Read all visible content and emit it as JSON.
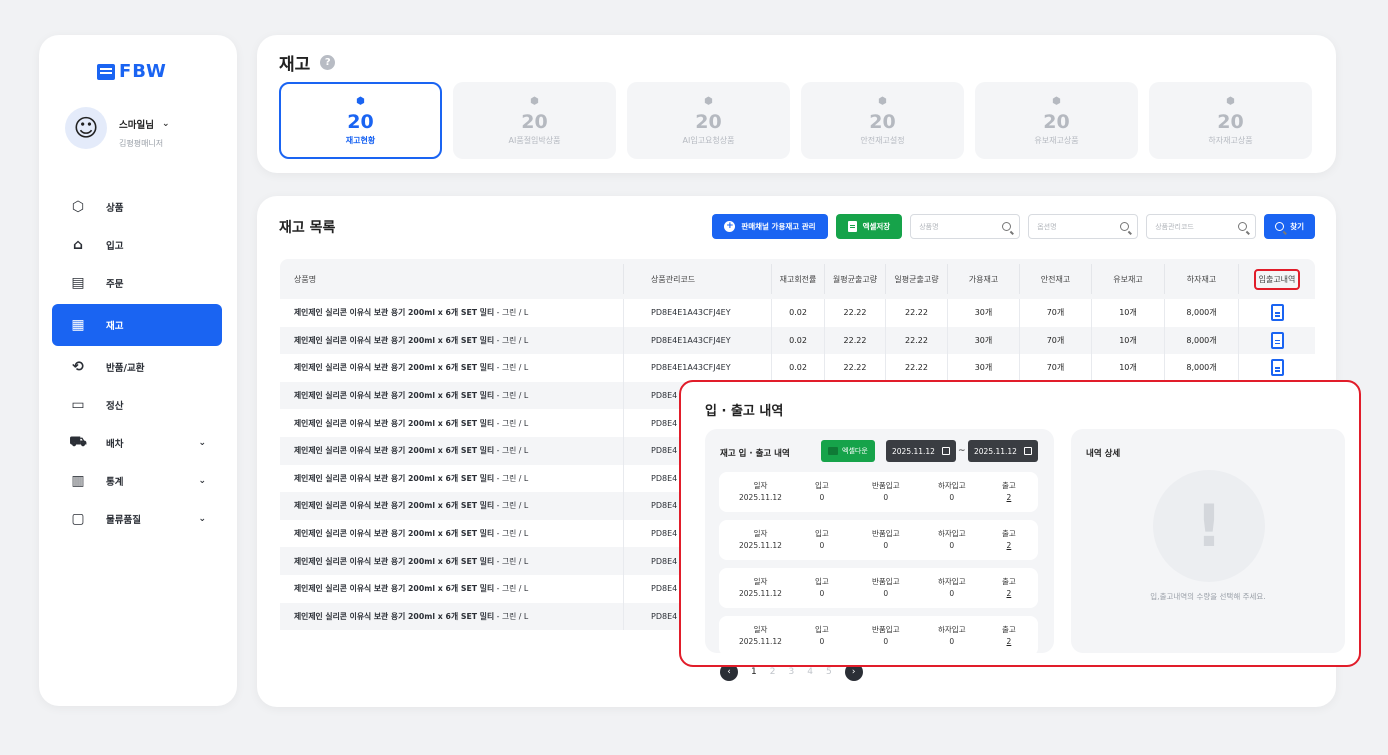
{
  "brand": {
    "logo": "FBW"
  },
  "user": {
    "name": "스마일님",
    "role": "김평평매니저"
  },
  "sidebar": {
    "items": [
      {
        "label": "상품",
        "icon": "box-icon"
      },
      {
        "label": "입고",
        "icon": "warehouse-icon"
      },
      {
        "label": "주문",
        "icon": "receipt-icon"
      },
      {
        "label": "재고",
        "icon": "grid-icon",
        "active": true
      },
      {
        "label": "반품/교환",
        "icon": "exchange-icon"
      },
      {
        "label": "정산",
        "icon": "card-icon"
      },
      {
        "label": "배차",
        "icon": "car-icon",
        "expandable": true
      },
      {
        "label": "통계",
        "icon": "chart-icon",
        "expandable": true
      },
      {
        "label": "물류품질",
        "icon": "chat-icon",
        "expandable": true
      }
    ]
  },
  "header": {
    "title": "재고"
  },
  "stats": [
    {
      "value": "20",
      "label": "재고현황",
      "active": true
    },
    {
      "value": "20",
      "label": "AI품절임박상품"
    },
    {
      "value": "20",
      "label": "AI입고요청상품"
    },
    {
      "value": "20",
      "label": "안전재고설정"
    },
    {
      "value": "20",
      "label": "유보재고상품"
    },
    {
      "value": "20",
      "label": "하자재고상품"
    }
  ],
  "list": {
    "title": "재고 목록",
    "btn_channel": "판매채널 가용재고 관리",
    "btn_excel": "엑셀저장",
    "ph_product": "상품명",
    "ph_option": "옵션명",
    "ph_code": "상품관리코드",
    "btn_search": "찾기",
    "columns": [
      "상품명",
      "상품관리코드",
      "재고회전률",
      "월평균출고량",
      "일평균출고량",
      "가용재고",
      "안전재고",
      "유보재고",
      "하자재고",
      "입출고내역"
    ],
    "rows": [
      {
        "name": "제인제인 실리콘 이유식 보관 용기 200ml x 6개 SET 밀티",
        "opt": " - 그린 / L",
        "code": "PD8E4E1A43CFJ4EY",
        "turn": "0.02",
        "month": "22.22",
        "day": "22.22",
        "avail": "30개",
        "safe": "70개",
        "reserve": "10개",
        "defect": "8,000개"
      },
      {
        "name": "제인제인 실리콘 이유식 보관 용기 200ml x 6개 SET 밀티",
        "opt": " - 그린 / L",
        "code": "PD8E4E1A43CFJ4EY",
        "turn": "0.02",
        "month": "22.22",
        "day": "22.22",
        "avail": "30개",
        "safe": "70개",
        "reserve": "10개",
        "defect": "8,000개"
      },
      {
        "name": "제인제인 실리콘 이유식 보관 용기 200ml x 6개 SET 밀티",
        "opt": " - 그린 / L",
        "code": "PD8E4E1A43CFJ4EY",
        "turn": "0.02",
        "month": "22.22",
        "day": "22.22",
        "avail": "30개",
        "safe": "70개",
        "reserve": "10개",
        "defect": "8,000개"
      },
      {
        "name": "제인제인 실리콘 이유식 보관 용기 200ml x 6개 SET 밀티",
        "opt": " - 그린 / L",
        "code": "PD8E4"
      },
      {
        "name": "제인제인 실리콘 이유식 보관 용기 200ml x 6개 SET 밀티",
        "opt": " - 그린 / L",
        "code": "PD8E4"
      },
      {
        "name": "제인제인 실리콘 이유식 보관 용기 200ml x 6개 SET 밀티",
        "opt": " - 그린 / L",
        "code": "PD8E4"
      },
      {
        "name": "제인제인 실리콘 이유식 보관 용기 200ml x 6개 SET 밀티",
        "opt": " - 그린 / L",
        "code": "PD8E4"
      },
      {
        "name": "제인제인 실리콘 이유식 보관 용기 200ml x 6개 SET 밀티",
        "opt": " - 그린 / L",
        "code": "PD8E4"
      },
      {
        "name": "제인제인 실리콘 이유식 보관 용기 200ml x 6개 SET 밀티",
        "opt": " - 그린 / L",
        "code": "PD8E4"
      },
      {
        "name": "제인제인 실리콘 이유식 보관 용기 200ml x 6개 SET 밀티",
        "opt": " - 그린 / L",
        "code": "PD8E4"
      },
      {
        "name": "제인제인 실리콘 이유식 보관 용기 200ml x 6개 SET 밀티",
        "opt": " - 그린 / L",
        "code": "PD8E4"
      },
      {
        "name": "제인제인 실리콘 이유식 보관 용기 200ml x 6개 SET 밀티",
        "opt": " - 그린 / L",
        "code": "PD8E4"
      }
    ]
  },
  "pagination": {
    "pages": [
      "1",
      "2",
      "3",
      "4",
      "5"
    ],
    "current": "1"
  },
  "modal": {
    "title": "입 · 출고 내역",
    "panel_title": "재고 입 · 출고 내역",
    "excel": "엑셀다운",
    "date_from": "2025.11.12",
    "date_to": "2025.11.12",
    "date_sep": "~",
    "headers": [
      "일자",
      "입고",
      "반품입고",
      "하자입고",
      "출고"
    ],
    "records": [
      {
        "date": "2025.11.12",
        "in": "0",
        "return": "0",
        "defect": "0",
        "out": "2"
      },
      {
        "date": "2025.11.12",
        "in": "0",
        "return": "0",
        "defect": "0",
        "out": "2"
      },
      {
        "date": "2025.11.12",
        "in": "0",
        "return": "0",
        "defect": "0",
        "out": "2"
      },
      {
        "date": "2025.11.12",
        "in": "0",
        "return": "0",
        "defect": "0",
        "out": "2"
      }
    ],
    "detail_title": "내역 상세",
    "detail_symbol": "!",
    "detail_msg": "입,출고내역의 수량을 선택해 주세요."
  }
}
